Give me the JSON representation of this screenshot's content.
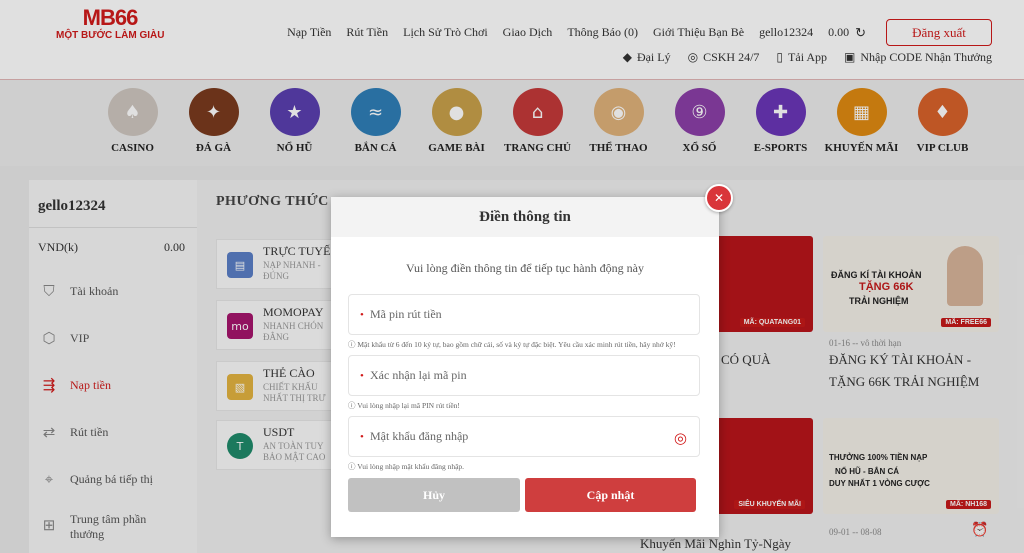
{
  "logo": {
    "main": "MB66",
    "tagline": "MỘT BƯỚC LÀM GIÀU"
  },
  "topnav": {
    "links": [
      "Nạp Tiền",
      "Rút Tiền",
      "Lịch Sử Trò Chơi",
      "Giao Dịch",
      "Thông Báo (0)",
      "Giới Thiệu Bạn Bè"
    ],
    "username": "gello12324",
    "balance": "0.00",
    "logout_label": "Đăng xuất"
  },
  "subnav": [
    "Đại Lý",
    "CSKH 24/7",
    "Tải App",
    "Nhập CODE Nhận Thưởng"
  ],
  "categories": [
    "CASINO",
    "ĐÁ GÀ",
    "NỔ HŨ",
    "BẮN CÁ",
    "GAME BÀI",
    "TRANG CHỦ",
    "THỂ THAO",
    "XỔ SỐ",
    "E-SPORTS",
    "KHUYẾN MÃI",
    "VIP CLUB"
  ],
  "sidebar": {
    "username": "gello12324",
    "currency": "VND(k)",
    "balance": "0.00",
    "items": [
      "Tài khoản",
      "VIP",
      "Nạp tiền",
      "Rút tiền",
      "Quảng bá tiếp thị",
      "Trung tâm phần thưởng"
    ]
  },
  "content": {
    "title": "PHƯƠNG THỨC",
    "methods": [
      {
        "name": "TRỰC TUYẾ",
        "desc": "NẠP NHANH - ĐÚNG"
      },
      {
        "name": "MOMOPAY",
        "desc": "NHANH CHÓN ĐẲNG"
      },
      {
        "name": "THẺ CÀO",
        "desc": "CHIẾT KHẤU NHẤT THỊ TRƯ"
      },
      {
        "name": "USDT",
        "desc": "AN TOÀN TUY BẢO MẬT CAO"
      }
    ],
    "promos": [
      {
        "code": "MÃ: QUATANG01",
        "date": "",
        "title": "CÓ QUÀ"
      },
      {
        "headline1": "ĐĂNG KÍ TÀI KHOẢN",
        "headline2": "TẶNG 66K",
        "headline3": "TRẢI NGHIỆM",
        "code": "MÃ: FREE66",
        "date": "01-16 -- vô thời hạn",
        "title1": "ĐĂNG KÝ TÀI KHOẢN -",
        "title2": "TẶNG 66K TRẢI NGHIỆM"
      },
      {
        "code": "SIÊU KHUYẾN MÃI",
        "title": "Khuyến Mãi Nghìn Tỷ-Ngày"
      },
      {
        "headline1": "THƯỞNG 100% TIỀN NẠP",
        "headline2": "NỔ HŨ - BẮN CÁ",
        "headline3": "DUY NHẤT 1 VÒNG CƯỢC",
        "code": "MÃ: NH168",
        "date": "09-01 -- 08-08"
      }
    ]
  },
  "modal": {
    "title": "Điền thông tin",
    "subtitle": "Vui lòng điền thông tin để tiếp tục hành động này",
    "pin_placeholder": "Mã pin rút tiền",
    "pin_hint": "ⓘ Mật khẩu từ 6 đến 10 ký tự, bao gồm chữ cái, số và ký tự đặc biệt. Yêu cầu xác minh rút tiền, hãy nhớ kỹ!",
    "confirm_placeholder": "Xác nhận lại mã pin",
    "confirm_hint": "ⓘ Vui lòng nhập lại mã PIN rút tiền!",
    "password_placeholder": "Mật khẩu đăng nhập",
    "password_hint": "ⓘ Vui lòng nhập mật khẩu đăng nhập.",
    "cancel_label": "Hủy",
    "submit_label": "Cập nhật"
  },
  "colors": {
    "brand": "#d11b1b",
    "submit": "#cf3e3e",
    "cancel": "#c1c1c1"
  }
}
